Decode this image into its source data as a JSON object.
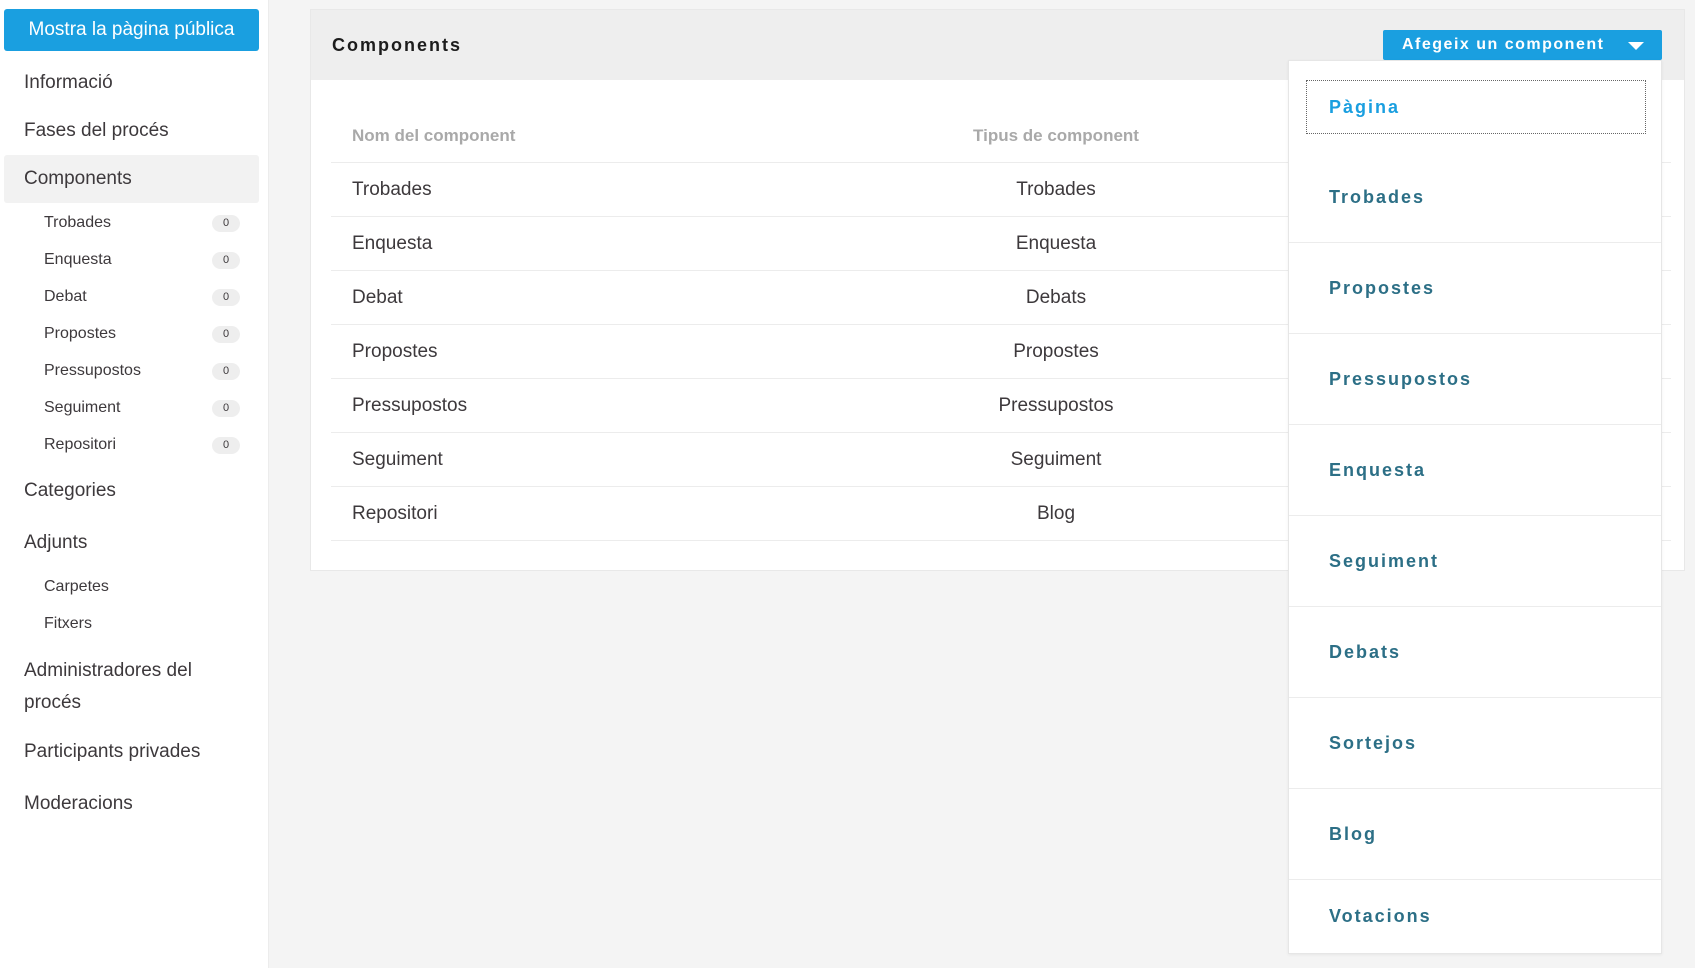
{
  "sidebar": {
    "public_button": "Mostra la pàgina pública",
    "items": [
      {
        "label": "Informació"
      },
      {
        "label": "Fases del procés"
      },
      {
        "label": "Components"
      },
      {
        "label": "Categories"
      },
      {
        "label": "Adjunts"
      },
      {
        "label": "Administradores del procés"
      },
      {
        "label": "Participants privades"
      },
      {
        "label": "Moderacions"
      }
    ],
    "components_sub": [
      {
        "label": "Trobades",
        "count": "0"
      },
      {
        "label": "Enquesta",
        "count": "0"
      },
      {
        "label": "Debat",
        "count": "0"
      },
      {
        "label": "Propostes",
        "count": "0"
      },
      {
        "label": "Pressupostos",
        "count": "0"
      },
      {
        "label": "Seguiment",
        "count": "0"
      },
      {
        "label": "Repositori",
        "count": "0"
      }
    ],
    "adjunts_sub": [
      {
        "label": "Carpetes"
      },
      {
        "label": "Fitxers"
      }
    ]
  },
  "main": {
    "title": "Components",
    "add_button": "Afegeix un component",
    "table": {
      "headers": [
        "Nom del component",
        "Tipus de component"
      ],
      "rows": [
        [
          "Trobades",
          "Trobades"
        ],
        [
          "Enquesta",
          "Enquesta"
        ],
        [
          "Debat",
          "Debats"
        ],
        [
          "Propostes",
          "Propostes"
        ],
        [
          "Pressupostos",
          "Pressupostos"
        ],
        [
          "Seguiment",
          "Seguiment"
        ],
        [
          "Repositori",
          "Blog"
        ]
      ]
    },
    "dropdown": [
      "Pàgina",
      "Trobades",
      "Propostes",
      "Pressupostos",
      "Enquesta",
      "Seguiment",
      "Debats",
      "Sortejos",
      "Blog",
      "Votacions"
    ]
  },
  "colors": {
    "accent": "#1a9fe0",
    "dropdown_text": "#2c6f86"
  },
  "icons": {
    "add_button": "caret-down-icon"
  }
}
